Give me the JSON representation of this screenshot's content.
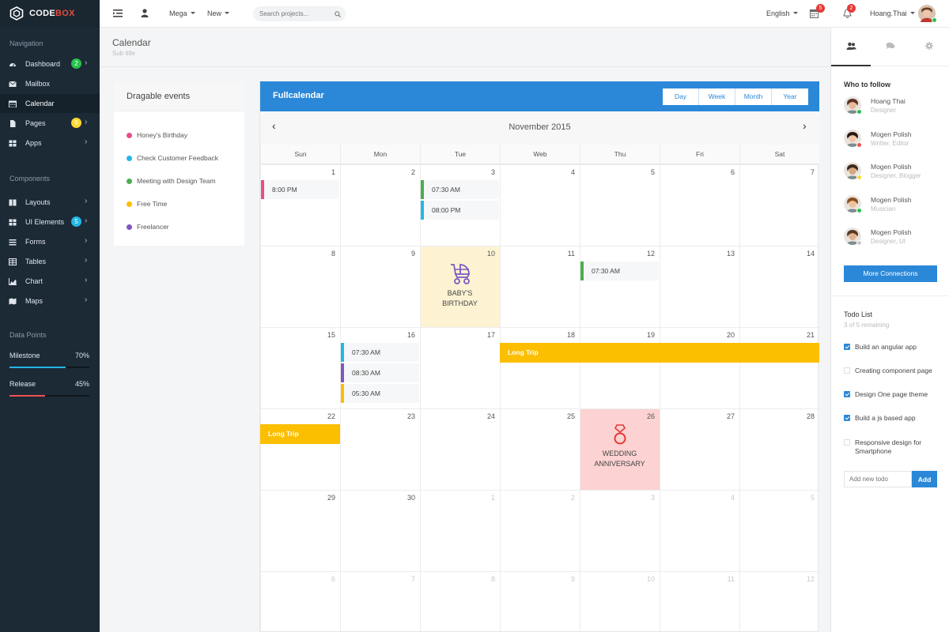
{
  "brand": {
    "part1": "CODE",
    "part2": "BOX"
  },
  "sidebar": {
    "nav_title": "Navigation",
    "items": [
      {
        "label": "Dashboard",
        "icon": "dashboard-icon",
        "badge": "2",
        "badge_color": "#27c24c",
        "chevron": true
      },
      {
        "label": "Mailbox",
        "icon": "envelope-icon"
      },
      {
        "label": "Calendar",
        "icon": "calendar-icon",
        "active": true
      },
      {
        "label": "Pages",
        "icon": "file-icon",
        "badge": "8",
        "badge_color": "#fad733",
        "chevron": true
      },
      {
        "label": "Apps",
        "icon": "grid-icon",
        "chevron": true
      }
    ],
    "components_title": "Components",
    "components": [
      {
        "label": "Layouts",
        "icon": "columns-icon",
        "chevron": true
      },
      {
        "label": "UI Elements",
        "icon": "grid-icon",
        "badge": "5",
        "badge_color": "#23b7e5",
        "chevron": true
      },
      {
        "label": "Forms",
        "icon": "list-icon",
        "chevron": true
      },
      {
        "label": "Tables",
        "icon": "table-icon",
        "chevron": true
      },
      {
        "label": "Chart",
        "icon": "area-chart-icon",
        "chevron": true
      },
      {
        "label": "Maps",
        "icon": "map-icon",
        "chevron": true
      }
    ],
    "datapoints_title": "Data Points",
    "datapoints": [
      {
        "label": "Milestone",
        "value": "70%",
        "fraction": 0.7,
        "color": "#23b7e5"
      },
      {
        "label": "Release",
        "value": "45%",
        "fraction": 0.45,
        "color": "#f05050"
      }
    ]
  },
  "topbar": {
    "mega": "Mega",
    "new": "New",
    "search_placeholder": "Search projects...",
    "language": "English",
    "calendar_badge": "5",
    "bell_badge": "2",
    "user": "Hoang.Thai"
  },
  "page": {
    "title": "Calendar",
    "subtitle": "Sub title"
  },
  "dragable": {
    "title": "Dragable events",
    "events": [
      {
        "label": "Honey's Birthday",
        "color": "#e84c8a"
      },
      {
        "label": "Check Customer Feedback",
        "color": "#23b7e5"
      },
      {
        "label": "Meeting with Design Team",
        "color": "#4cae4f"
      },
      {
        "label": "Free Time",
        "color": "#fcbf00"
      },
      {
        "label": "Freelancer",
        "color": "#7e57c2"
      }
    ]
  },
  "calendar": {
    "title": "Fullcalendar",
    "views": [
      "Day",
      "Week",
      "Month",
      "Year"
    ],
    "month": "November 2015",
    "weekdays": [
      "Sun",
      "Mon",
      "Tue",
      "Web",
      "Thu",
      "Fri",
      "Sat"
    ],
    "weeks": [
      [
        1,
        2,
        3,
        4,
        5,
        6,
        7
      ],
      [
        8,
        9,
        10,
        11,
        12,
        13,
        14
      ],
      [
        15,
        16,
        17,
        18,
        19,
        20,
        21
      ],
      [
        22,
        23,
        24,
        25,
        26,
        27,
        28
      ],
      [
        29,
        30,
        1,
        2,
        3,
        4,
        5
      ],
      [
        6,
        7,
        8,
        9,
        10,
        11,
        12
      ]
    ],
    "events": [
      {
        "week": 0,
        "day": 0,
        "slot": 0,
        "time": "8:00 PM",
        "color": "#e84c8a"
      },
      {
        "week": 0,
        "day": 2,
        "slot": 0,
        "time": "07:30 AM",
        "color": "#4cae4f"
      },
      {
        "week": 0,
        "day": 2,
        "slot": 1,
        "time": "08:00 PM",
        "color": "#23b7e5"
      },
      {
        "week": 1,
        "day": 4,
        "slot": 0,
        "time": "07:30 AM",
        "color": "#4cae4f"
      },
      {
        "week": 2,
        "day": 1,
        "slot": 0,
        "time": "07:30 AM",
        "color": "#23b7e5"
      },
      {
        "week": 2,
        "day": 1,
        "slot": 1,
        "time": "08:30 AM",
        "color": "#7e57c2"
      },
      {
        "week": 2,
        "day": 1,
        "slot": 2,
        "time": "05:30 AM",
        "color": "#fcbf00"
      }
    ],
    "long_trip": "Long Trip",
    "baby_birthday": {
      "line1": "BABY'S",
      "line2": "BIRTHDAY"
    },
    "wedding": {
      "line1": "WEDDING",
      "line2": "ANNIVERSARY"
    }
  },
  "right_panel": {
    "who_title": "Who to follow",
    "people": [
      {
        "name": "Hoang Thai",
        "role": "Designer",
        "status": "#27c24c"
      },
      {
        "name": "Mogen Polish",
        "role": "Writter, Editor",
        "status": "#f05050"
      },
      {
        "name": "Mogen Polish",
        "role": "Designer, Blogger",
        "status": "#fad733"
      },
      {
        "name": "Mogen Polish",
        "role": "Musician",
        "status": "#27c24c"
      },
      {
        "name": "Mogen Polish",
        "role": "Designer, UI",
        "status": "#cccccc"
      }
    ],
    "more_button": "More Connections",
    "todo_title": "Todo List",
    "todo_sub": "3 of 5 remaining",
    "todos": [
      {
        "text": "Build an angular app",
        "checked": true
      },
      {
        "text": "Creating component page",
        "checked": false
      },
      {
        "text": "Design One page theme",
        "checked": true
      },
      {
        "text": "Build a js based app",
        "checked": true
      },
      {
        "text": "Responsive design for Smartphone",
        "checked": false
      }
    ],
    "todo_placeholder": "Add new todo",
    "todo_add": "Add"
  }
}
